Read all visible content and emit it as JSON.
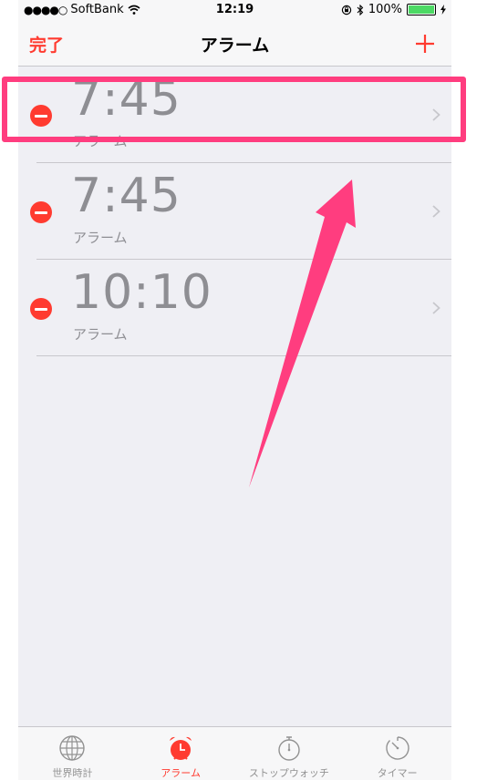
{
  "status_bar": {
    "signal_dots": "●●●●○",
    "carrier": "SoftBank",
    "time": "12:19",
    "battery": "100%",
    "battery_level": 1.0
  },
  "nav": {
    "done_label": "完了",
    "title": "アラーム",
    "add_icon": "plus-icon"
  },
  "alarms": [
    {
      "time": "7:45",
      "label": "アラーム"
    },
    {
      "time": "7:45",
      "label": "アラーム"
    },
    {
      "time": "10:10",
      "label": "アラーム"
    }
  ],
  "tabs": [
    {
      "label": "世界時計",
      "icon": "globe-icon",
      "active": false
    },
    {
      "label": "アラーム",
      "icon": "alarm-clock-icon",
      "active": true
    },
    {
      "label": "ストップウォッチ",
      "icon": "stopwatch-icon",
      "active": false
    },
    {
      "label": "タイマー",
      "icon": "timer-icon",
      "active": false
    }
  ],
  "colors": {
    "accent": "#ff3b30",
    "annotation": "#ff3d7f",
    "battery": "#4cd964"
  }
}
